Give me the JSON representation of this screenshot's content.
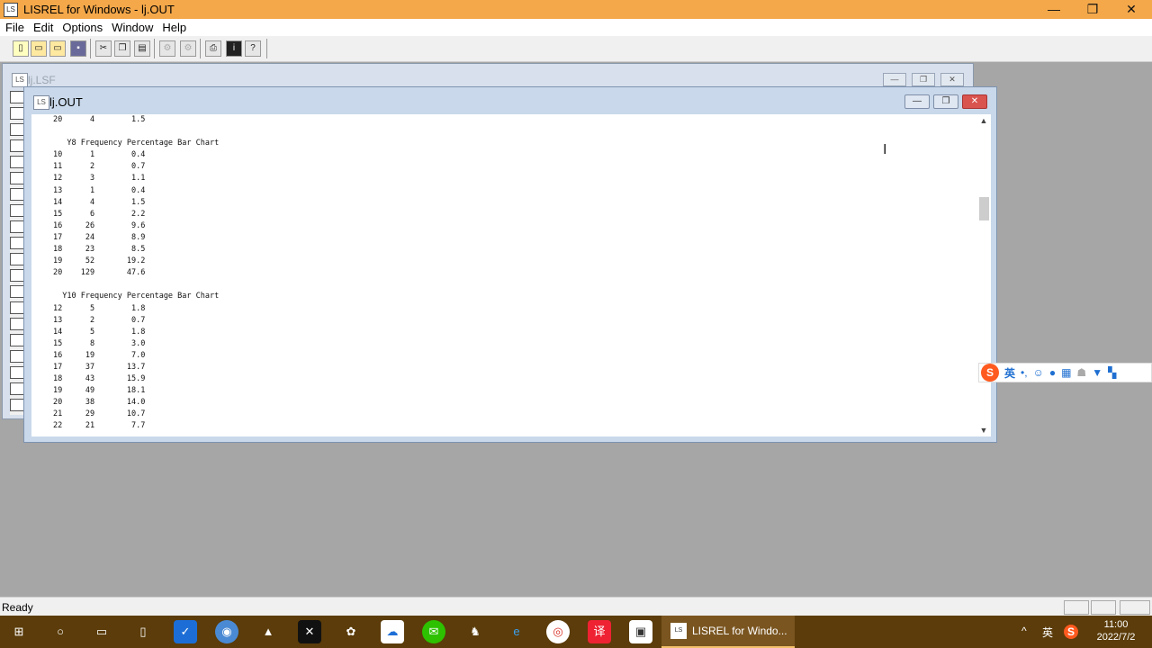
{
  "app": {
    "title": "LISREL for Windows - lj.OUT",
    "icon": "lisrel-app-icon",
    "controls": {
      "minimize": "—",
      "restore": "❐",
      "close": "✕"
    }
  },
  "menu": [
    "File",
    "Edit",
    "Options",
    "Window",
    "Help"
  ],
  "toolbar_icons": [
    "new-icon",
    "open-icon",
    "open-folder-icon",
    "save-icon",
    "cut-icon",
    "copy-icon",
    "paste-icon",
    "path-diagram-icon",
    "path-diagram-2-icon",
    "print-icon",
    "info-icon",
    "help-icon"
  ],
  "lsf_window": {
    "title": "lj.LSF"
  },
  "out_window": {
    "title": "lj.OUT",
    "lines": [
      "20      4        1.5",
      "",
      "   Y8 Frequency Percentage Bar Chart",
      "10      1        0.4",
      "11      2        0.7",
      "12      3        1.1",
      "13      1        0.4",
      "14      4        1.5",
      "15      6        2.2",
      "16     26        9.6",
      "17     24        8.9",
      "18     23        8.5",
      "19     52       19.2",
      "20    129       47.6",
      "",
      "  Y10 Frequency Percentage Bar Chart",
      "12      5        1.8",
      "13      2        0.7",
      "14      5        1.8",
      "15      8        3.0",
      "16     19        7.0",
      "17     37       13.7",
      "18     43       15.9",
      "19     49       18.1",
      "20     38       14.0",
      "21     29       10.7",
      "22     21        7.7"
    ]
  },
  "ime": {
    "logo": "S",
    "lang": "英",
    "icons": [
      "punctuation-icon",
      "emoji-icon",
      "microphone-icon",
      "keyboard-icon",
      "user-icon",
      "skin-icon",
      "toolbox-icon"
    ]
  },
  "status": {
    "text": "Ready"
  },
  "taskbar": {
    "active_label": "LISREL for Windo...",
    "tray_lang": "英",
    "tray_chevron": "^",
    "time": "11:00",
    "date": "2022/7/2"
  }
}
